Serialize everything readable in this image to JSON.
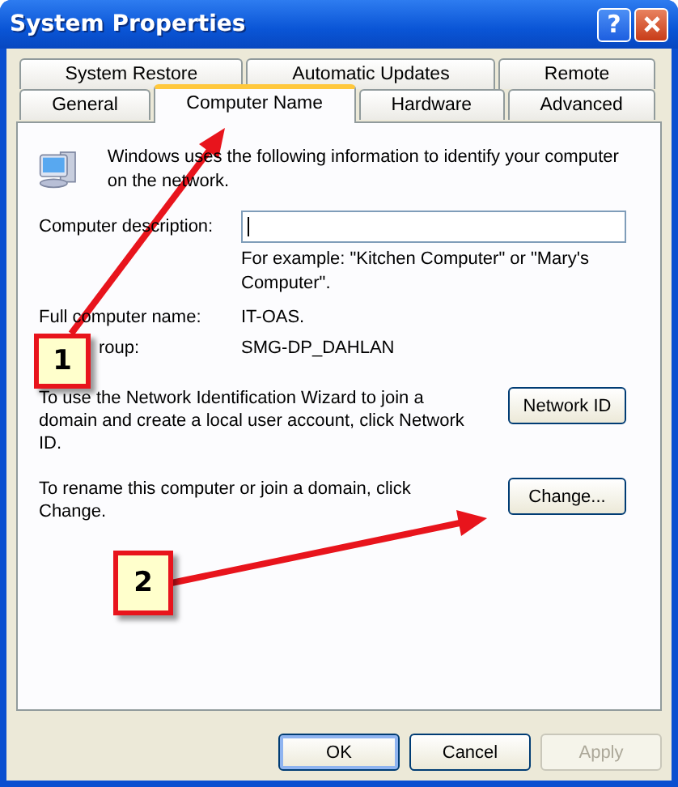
{
  "window": {
    "title": "System Properties",
    "help": "?"
  },
  "tabs_back": [
    {
      "label": "System Restore",
      "selected": false
    },
    {
      "label": "Automatic Updates",
      "selected": false
    },
    {
      "label": "Remote",
      "selected": false
    }
  ],
  "tabs_front": [
    {
      "label": "General",
      "selected": false
    },
    {
      "label": "Computer Name",
      "selected": true
    },
    {
      "label": "Hardware",
      "selected": false
    },
    {
      "label": "Advanced",
      "selected": false
    }
  ],
  "intro": "Windows uses the following information to identify your computer on the network.",
  "description": {
    "label": "Computer description:",
    "hint": "For example: \"Kitchen Computer\" or \"Mary's Computer\"."
  },
  "fields": [
    {
      "label": "Full computer name:",
      "value": "IT-OAS."
    },
    {
      "label": "roup:",
      "value": "SMG-DP_DAHLAN"
    }
  ],
  "actions": [
    {
      "text": "To use the Network Identification Wizard to join a domain and create a local user account, click Network ID.",
      "button": "Network ID"
    },
    {
      "text": "To rename this computer or join a domain, click Change.",
      "button": "Change..."
    }
  ],
  "buttons": [
    {
      "label": "OK",
      "default": true,
      "disabled": false
    },
    {
      "label": "Cancel",
      "default": false,
      "disabled": false
    },
    {
      "label": "Apply",
      "default": false,
      "disabled": true
    }
  ],
  "callouts": [
    {
      "number": "1"
    },
    {
      "number": "2"
    }
  ]
}
